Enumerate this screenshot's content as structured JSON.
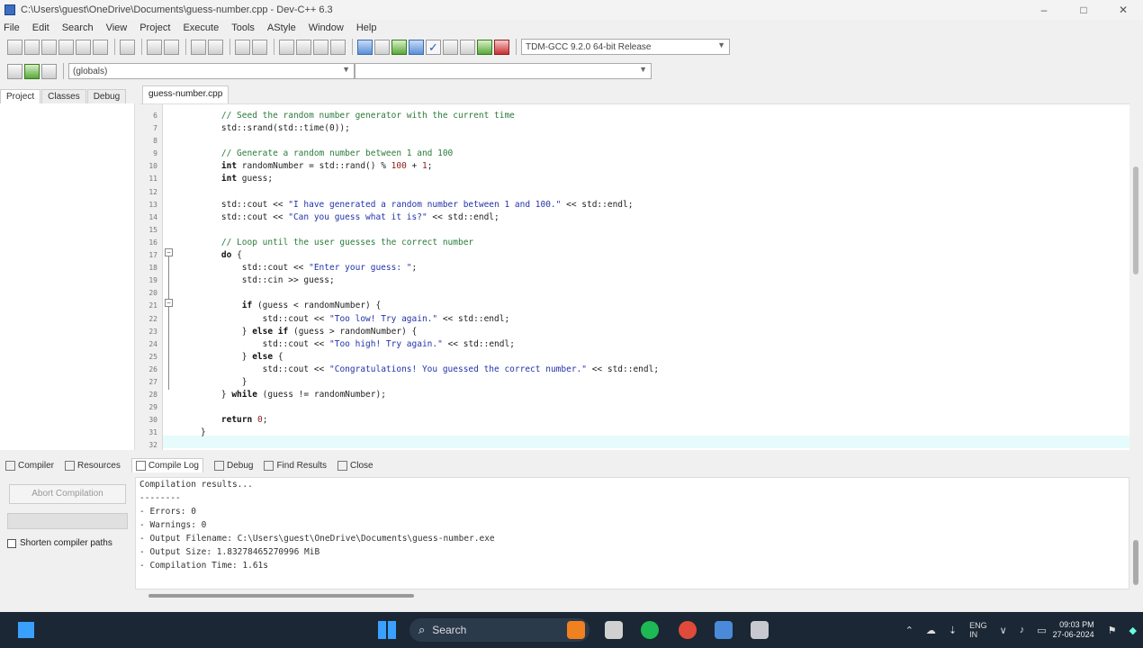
{
  "window": {
    "title": "C:\\Users\\guest\\OneDrive\\Documents\\guess-number.cpp - Dev-C++ 6.3",
    "controls": [
      "–",
      "□",
      "✕"
    ]
  },
  "menu": [
    "File",
    "Edit",
    "Search",
    "View",
    "Project",
    "Execute",
    "Tools",
    "AStyle",
    "Window",
    "Help"
  ],
  "toolbar": {
    "compiler_select": "TDM-GCC 9.2.0 64-bit Release",
    "function_select": "(globals)"
  },
  "left_tabs": [
    "Project",
    "Classes",
    "Debug"
  ],
  "file_tab": "guess-number.cpp",
  "code_lines": [
    {
      "n": "6",
      "html": "<span class=\"cmt\">    // Seed the random number generator with the current time</span>"
    },
    {
      "n": "7",
      "html": "    std::srand(std::time(0));"
    },
    {
      "n": "8",
      "html": ""
    },
    {
      "n": "9",
      "html": "<span class=\"cmt\">    // Generate a random number between 1 and 100</span>"
    },
    {
      "n": "10",
      "html": "    <span class=\"kw\">int</span> randomNumber = std::rand() % <span class=\"num\">100</span> + <span class=\"num\">1</span>;"
    },
    {
      "n": "11",
      "html": "    <span class=\"kw\">int</span> guess;"
    },
    {
      "n": "12",
      "html": ""
    },
    {
      "n": "13",
      "html": "    std::cout &lt;&lt; <span class=\"str\">\"I have generated a random number between 1 and 100.\"</span> &lt;&lt; std::endl;"
    },
    {
      "n": "14",
      "html": "    std::cout &lt;&lt; <span class=\"str\">\"Can you guess what it is?\"</span> &lt;&lt; std::endl;"
    },
    {
      "n": "15",
      "html": ""
    },
    {
      "n": "16",
      "html": "<span class=\"cmt\">    // Loop until the user guesses the correct number</span>"
    },
    {
      "n": "17",
      "html": "    <span class=\"kw\">do</span> {"
    },
    {
      "n": "18",
      "html": "        std::cout &lt;&lt; <span class=\"str\">\"Enter your guess: \"</span>;"
    },
    {
      "n": "19",
      "html": "        std::cin &gt;&gt; guess;"
    },
    {
      "n": "20",
      "html": ""
    },
    {
      "n": "21",
      "html": "        <span class=\"kw\">if</span> (guess &lt; randomNumber) {"
    },
    {
      "n": "22",
      "html": "            std::cout &lt;&lt; <span class=\"str\">\"Too low! Try again.\"</span> &lt;&lt; std::endl;"
    },
    {
      "n": "23",
      "html": "        } <span class=\"kw\">else if</span> (guess &gt; randomNumber) {"
    },
    {
      "n": "24",
      "html": "            std::cout &lt;&lt; <span class=\"str\">\"Too high! Try again.\"</span> &lt;&lt; std::endl;"
    },
    {
      "n": "25",
      "html": "        } <span class=\"kw\">else</span> {"
    },
    {
      "n": "26",
      "html": "            std::cout &lt;&lt; <span class=\"str\">\"Congratulations! You guessed the correct number.\"</span> &lt;&lt; std::endl;"
    },
    {
      "n": "27",
      "html": "        }"
    },
    {
      "n": "28",
      "html": "    } <span class=\"kw\">while</span> (guess != randomNumber);"
    },
    {
      "n": "29",
      "html": ""
    },
    {
      "n": "30",
      "html": "    <span class=\"kw\">return</span> <span class=\"num\">0</span>;"
    },
    {
      "n": "31",
      "html": "}"
    },
    {
      "n": "32",
      "html": ""
    }
  ],
  "bottom_tabs": [
    "Compiler",
    "Resources",
    "Compile Log",
    "Debug",
    "Find Results",
    "Close"
  ],
  "bottom_left": {
    "abort_label": "Abort Compilation",
    "shorten_label": "Shorten compiler paths"
  },
  "log_lines": [
    "Compilation results...",
    "--------",
    "- Errors: 0",
    "- Warnings: 0",
    "- Output Filename: C:\\Users\\guest\\OneDrive\\Documents\\guess-number.exe",
    "- Output Size: 1.83278465270996 MiB",
    "- Compilation Time: 1.61s"
  ],
  "taskbar": {
    "search_label": "Search",
    "lang": "ENG\nIN",
    "time": "09:03 PM",
    "date": "27-06-2024"
  }
}
